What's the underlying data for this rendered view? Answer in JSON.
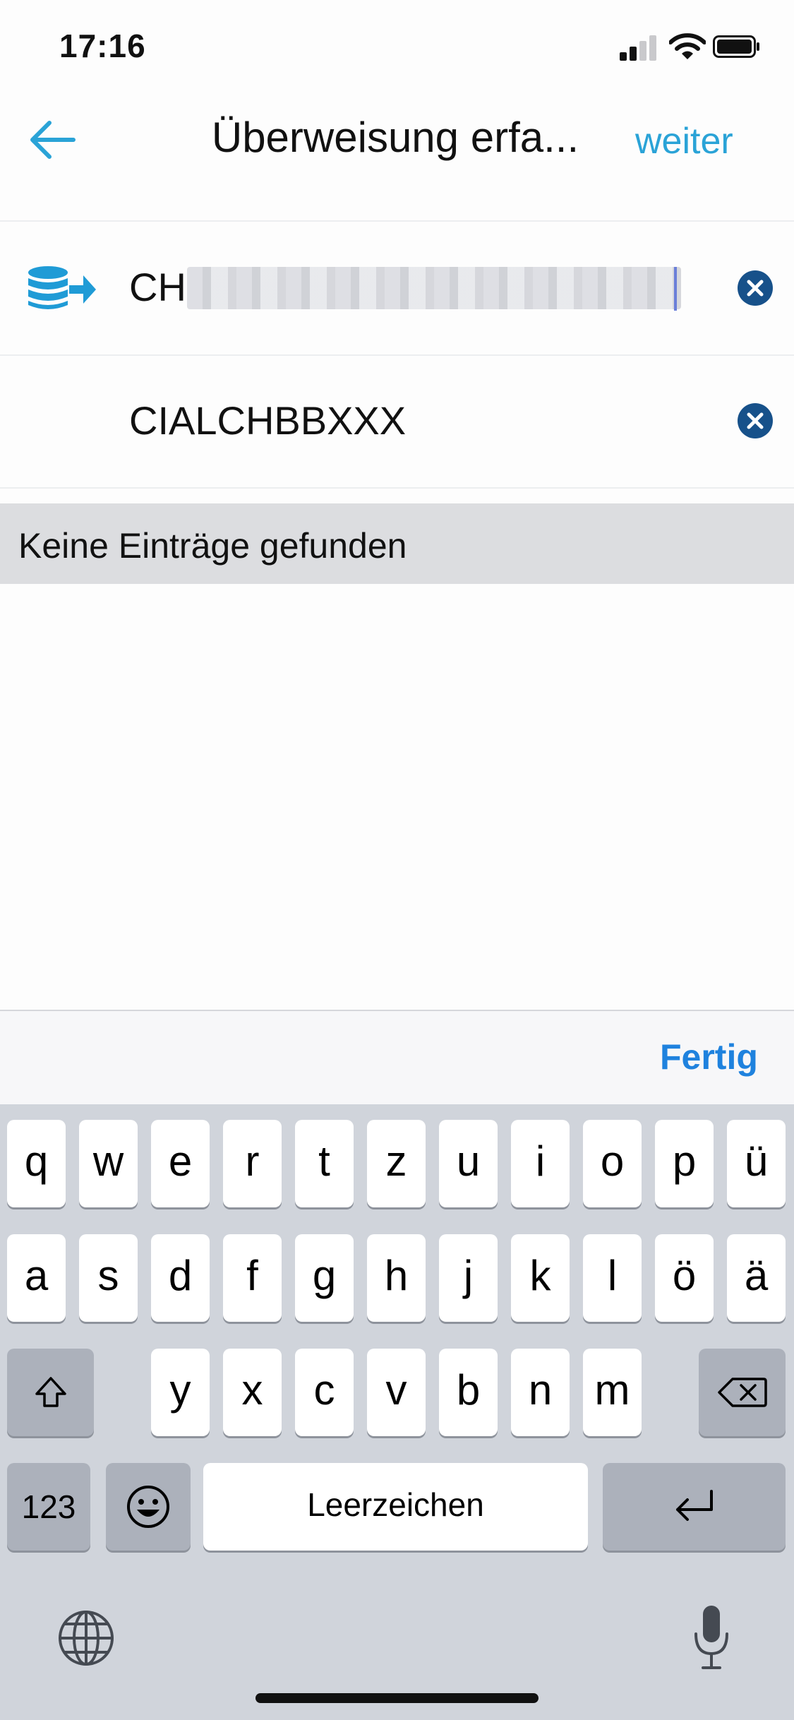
{
  "status": {
    "time": "17:16"
  },
  "nav": {
    "title": "Überweisung erfa...",
    "next_label": "weiter"
  },
  "form": {
    "iban_prefix": "CH",
    "bic_value": "CIALCHBBXXX"
  },
  "results": {
    "empty_message": "Keine Einträge gefunden"
  },
  "accessory": {
    "done_label": "Fertig"
  },
  "keyboard": {
    "row1": [
      "q",
      "w",
      "e",
      "r",
      "t",
      "z",
      "u",
      "i",
      "o",
      "p",
      "ü"
    ],
    "row2": [
      "a",
      "s",
      "d",
      "f",
      "g",
      "h",
      "j",
      "k",
      "l",
      "ö",
      "ä"
    ],
    "row3": [
      "y",
      "x",
      "c",
      "v",
      "b",
      "n",
      "m"
    ],
    "numbers_label": "123",
    "space_label": "Leerzeichen"
  },
  "colors": {
    "accent": "#2aa3d7",
    "clear_button": "#17518a",
    "done": "#1f82de"
  },
  "icons": {
    "back": "arrow-left-icon",
    "account": "database-transfer-icon",
    "clear": "close-circle-icon",
    "shift": "shift-icon",
    "backspace": "backspace-icon",
    "emoji": "emoji-icon",
    "return": "return-icon",
    "globe": "globe-icon",
    "mic": "microphone-icon"
  }
}
